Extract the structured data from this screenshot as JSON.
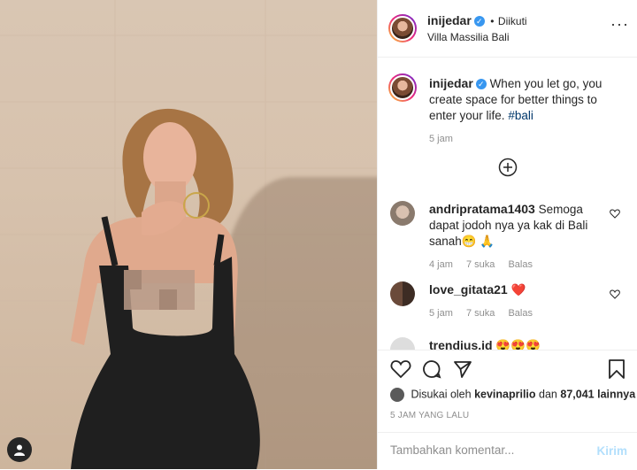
{
  "post": {
    "username": "inijedar",
    "follow_status": "Diikuti",
    "location": "Villa Massilia Bali",
    "caption": "When you let go, you create space for better things to enter your life.",
    "hashtag": "#bali",
    "caption_time": "5 jam"
  },
  "comments": [
    {
      "username": "andripratama1403",
      "text": "Semoga dapat jodoh nya ya kak di Bali sanah😁 🙏",
      "time": "4 jam",
      "likes": "7 suka",
      "reply": "Balas"
    },
    {
      "username": "love_gitata21",
      "text": "❤️",
      "time": "5 jam",
      "likes": "7 suka",
      "reply": "Balas"
    },
    {
      "username": "trendjus.id",
      "text": "😍😍😍",
      "time": "",
      "likes": "",
      "reply": ""
    }
  ],
  "likes": {
    "prefix": "Disukai oleh",
    "user": "kevinaprilio",
    "conj": "dan",
    "count": "87,041",
    "suffix": "lainnya"
  },
  "timestamp": "5 JAM YANG LALU",
  "add_comment": {
    "placeholder": "Tambahkan komentar...",
    "submit": "Kirim"
  },
  "icons": {
    "more": "more-horizontal-icon",
    "add": "plus-circle-icon",
    "like": "heart-icon",
    "comment": "comment-icon",
    "share": "share-icon",
    "save": "bookmark-icon"
  },
  "colors": {
    "verified": "#3897f0",
    "link": "#00376b",
    "heart": "#ed4956"
  }
}
